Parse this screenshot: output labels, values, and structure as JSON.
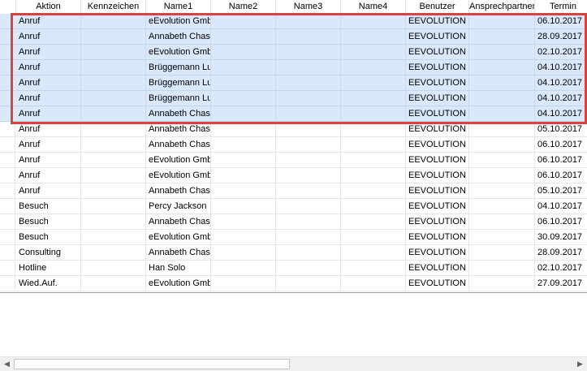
{
  "columns": [
    {
      "key": "aktion",
      "label": "Aktion"
    },
    {
      "key": "kennzeichen",
      "label": "Kennzeichen"
    },
    {
      "key": "name1",
      "label": "Name1"
    },
    {
      "key": "name2",
      "label": "Name2"
    },
    {
      "key": "name3",
      "label": "Name3"
    },
    {
      "key": "name4",
      "label": "Name4"
    },
    {
      "key": "benutzer",
      "label": "Benutzer"
    },
    {
      "key": "ansprechpartner",
      "label": "Ansprechpartner"
    },
    {
      "key": "termin",
      "label": "Termin"
    }
  ],
  "rows": [
    {
      "aktion": "Anruf",
      "kennzeichen": "",
      "name1": "eEvolution Gmbh",
      "name2": "",
      "name3": "",
      "name4": "",
      "benutzer": "EEVOLUTION",
      "ansprechpartner": "",
      "termin": "06.10.2017",
      "selected": true
    },
    {
      "aktion": "Anruf",
      "kennzeichen": "",
      "name1": "Annabeth Chase",
      "name2": "",
      "name3": "",
      "name4": "",
      "benutzer": "EEVOLUTION",
      "ansprechpartner": "",
      "termin": "28.09.2017",
      "selected": true
    },
    {
      "aktion": "Anruf",
      "kennzeichen": "",
      "name1": "eEvolution Gmbh",
      "name2": "",
      "name3": "",
      "name4": "",
      "benutzer": "EEVOLUTION",
      "ansprechpartner": "",
      "termin": "02.10.2017",
      "selected": true
    },
    {
      "aktion": "Anruf",
      "kennzeichen": "",
      "name1": "Brüggemann Luis",
      "name2": "",
      "name3": "",
      "name4": "",
      "benutzer": "EEVOLUTION",
      "ansprechpartner": "",
      "termin": "04.10.2017",
      "selected": true
    },
    {
      "aktion": "Anruf",
      "kennzeichen": "",
      "name1": "Brüggemann Luis",
      "name2": "",
      "name3": "",
      "name4": "",
      "benutzer": "EEVOLUTION",
      "ansprechpartner": "",
      "termin": "04.10.2017",
      "selected": true
    },
    {
      "aktion": "Anruf",
      "kennzeichen": "",
      "name1": "Brüggemann Luis",
      "name2": "",
      "name3": "",
      "name4": "",
      "benutzer": "EEVOLUTION",
      "ansprechpartner": "",
      "termin": "04.10.2017",
      "selected": true
    },
    {
      "aktion": "Anruf",
      "kennzeichen": "",
      "name1": "Annabeth Chase",
      "name2": "",
      "name3": "",
      "name4": "",
      "benutzer": "EEVOLUTION",
      "ansprechpartner": "",
      "termin": "04.10.2017",
      "selected": true
    },
    {
      "aktion": "Anruf",
      "kennzeichen": "",
      "name1": "Annabeth Chase",
      "name2": "",
      "name3": "",
      "name4": "",
      "benutzer": "EEVOLUTION",
      "ansprechpartner": "",
      "termin": "05.10.2017",
      "selected": false
    },
    {
      "aktion": "Anruf",
      "kennzeichen": "",
      "name1": "Annabeth Chase",
      "name2": "",
      "name3": "",
      "name4": "",
      "benutzer": "EEVOLUTION",
      "ansprechpartner": "",
      "termin": "06.10.2017",
      "selected": false
    },
    {
      "aktion": "Anruf",
      "kennzeichen": "",
      "name1": "eEvolution Gmbh",
      "name2": "",
      "name3": "",
      "name4": "",
      "benutzer": "EEVOLUTION",
      "ansprechpartner": "",
      "termin": "06.10.2017",
      "selected": false
    },
    {
      "aktion": "Anruf",
      "kennzeichen": "",
      "name1": "eEvolution Gmbh",
      "name2": "",
      "name3": "",
      "name4": "",
      "benutzer": "EEVOLUTION",
      "ansprechpartner": "",
      "termin": "06.10.2017",
      "selected": false
    },
    {
      "aktion": "Anruf",
      "kennzeichen": "",
      "name1": "Annabeth Chase",
      "name2": "",
      "name3": "",
      "name4": "",
      "benutzer": "EEVOLUTION",
      "ansprechpartner": "",
      "termin": "05.10.2017",
      "selected": false
    },
    {
      "aktion": "Besuch",
      "kennzeichen": "",
      "name1": "Percy Jackson",
      "name2": "",
      "name3": "",
      "name4": "",
      "benutzer": "EEVOLUTION",
      "ansprechpartner": "",
      "termin": "04.10.2017",
      "selected": false
    },
    {
      "aktion": "Besuch",
      "kennzeichen": "",
      "name1": "Annabeth Chase",
      "name2": "",
      "name3": "",
      "name4": "",
      "benutzer": "EEVOLUTION",
      "ansprechpartner": "",
      "termin": "06.10.2017",
      "selected": false
    },
    {
      "aktion": "Besuch",
      "kennzeichen": "",
      "name1": "eEvolution Gmbh",
      "name2": "",
      "name3": "",
      "name4": "",
      "benutzer": "EEVOLUTION",
      "ansprechpartner": "",
      "termin": "30.09.2017",
      "selected": false
    },
    {
      "aktion": "Consulting",
      "kennzeichen": "",
      "name1": "Annabeth Chase",
      "name2": "",
      "name3": "",
      "name4": "",
      "benutzer": "EEVOLUTION",
      "ansprechpartner": "",
      "termin": "28.09.2017",
      "selected": false
    },
    {
      "aktion": "Hotline",
      "kennzeichen": "",
      "name1": "Han Solo",
      "name2": "",
      "name3": "",
      "name4": "",
      "benutzer": "EEVOLUTION",
      "ansprechpartner": "",
      "termin": "02.10.2017",
      "selected": false
    },
    {
      "aktion": "Wied.Auf.",
      "kennzeichen": "",
      "name1": "eEvolution Gmbh",
      "name2": "",
      "name3": "",
      "name4": "",
      "benutzer": "EEVOLUTION",
      "ansprechpartner": "",
      "termin": "27.09.2017",
      "selected": false
    }
  ],
  "scrollbar": {
    "left_icon": "chevron-left-icon",
    "right_icon": "chevron-right-icon"
  },
  "colors": {
    "selection": "#d9e8fb",
    "highlight_border": "#d9423e"
  }
}
